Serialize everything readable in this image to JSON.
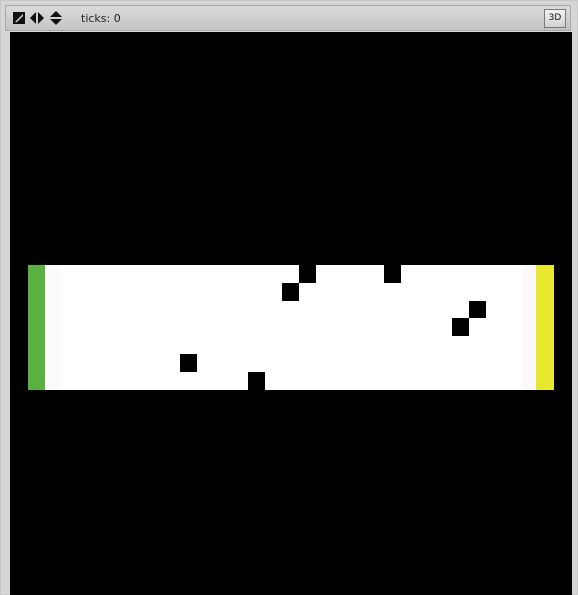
{
  "toolbar": {
    "ticks_label": "ticks: 0",
    "three_d_label": "3D"
  },
  "icons": {
    "zoom": "zoom-diagonal-icon",
    "horizontal": "left-right-arrows-icon",
    "vertical": "up-down-arrows-icon"
  },
  "colors": {
    "world_background": "#000000",
    "patch_floor": "#ffffff",
    "left_goal": "#5ab040",
    "right_goal": "#e8e830",
    "obstacle": "#000000"
  }
}
